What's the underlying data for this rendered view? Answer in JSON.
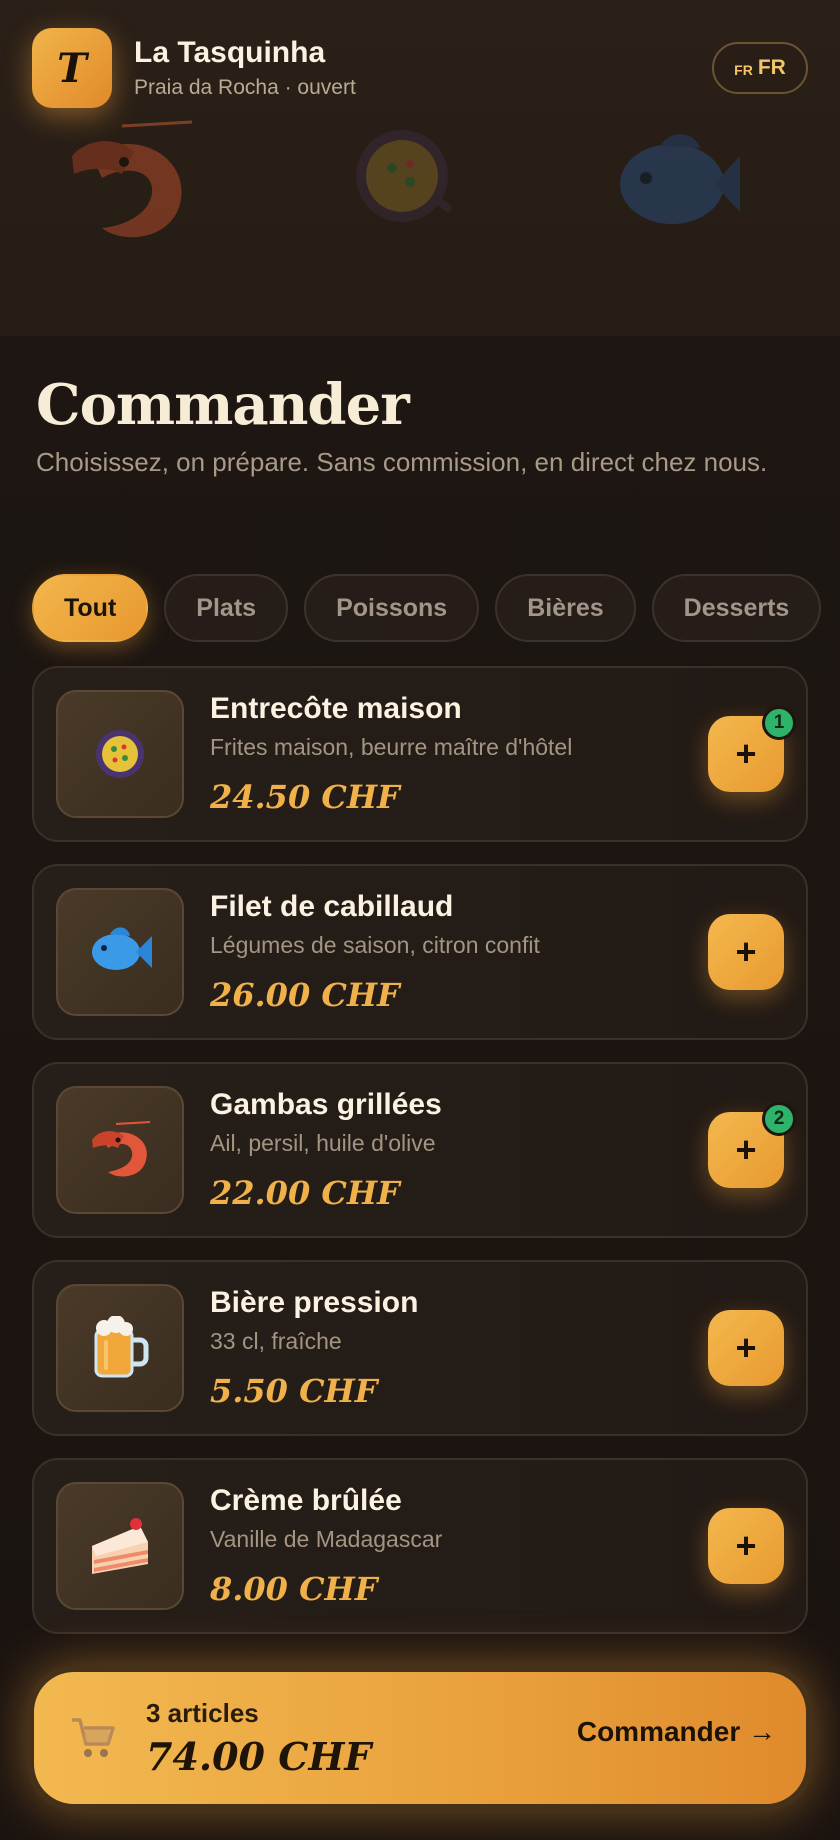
{
  "header": {
    "logo_letter": "T",
    "name": "La Tasquinha",
    "subtitle": "Praia da Rocha · ouvert",
    "lang_flag": "FR",
    "lang_code": "FR"
  },
  "hero": {
    "decor_icons": [
      "shrimp-icon",
      "paella-icon",
      "fish-icon"
    ]
  },
  "page": {
    "title": "Commander",
    "subtitle": "Choisissez, on prépare. Sans commission, en direct chez nous."
  },
  "tabs": [
    {
      "label": "Tout",
      "active": true
    },
    {
      "label": "Plats",
      "active": false
    },
    {
      "label": "Poissons",
      "active": false
    },
    {
      "label": "Bières",
      "active": false
    },
    {
      "label": "Desserts",
      "active": false
    }
  ],
  "items": [
    {
      "name": "Entrecôte maison",
      "description": "Frites maison, beurre maître d'hôtel",
      "price": "24.50 CHF",
      "icon": "paella-icon",
      "qty": "1"
    },
    {
      "name": "Filet de cabillaud",
      "description": "Légumes de saison, citron confit",
      "price": "26.00 CHF",
      "icon": "fish-icon",
      "qty": ""
    },
    {
      "name": "Gambas grillées",
      "description": "Ail, persil, huile d'olive",
      "price": "22.00 CHF",
      "icon": "shrimp-icon",
      "qty": "2"
    },
    {
      "name": "Bière pression",
      "description": "33 cl, fraîche",
      "price": "5.50 CHF",
      "icon": "beer-mug-icon",
      "qty": ""
    },
    {
      "name": "Crème brûlée",
      "description": "Vanille de Madagascar",
      "price": "8.00 CHF",
      "icon": "cake-slice-icon",
      "qty": ""
    }
  ],
  "add_label": "+",
  "cart": {
    "count": "3 articles",
    "total": "74.00 CHF",
    "cta": "Commander →",
    "icon": "cart-icon"
  },
  "colors": {
    "accent": "#f0b04a",
    "accent_dark": "#e08a2a",
    "badge": "#2fb36a",
    "background": "#1a1411"
  }
}
